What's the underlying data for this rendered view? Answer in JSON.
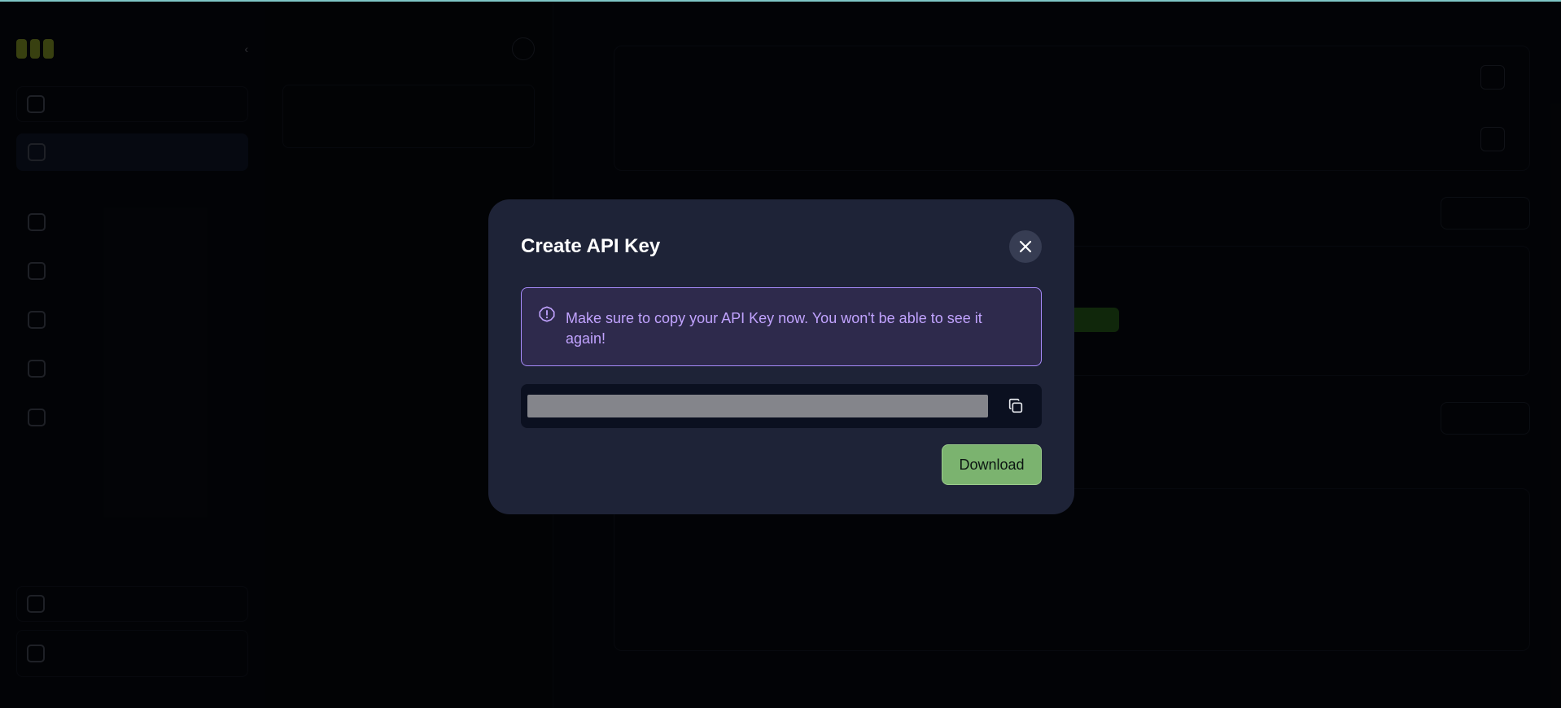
{
  "modal": {
    "title": "Create API Key",
    "alert_message": "Make sure to copy your API Key now. You won't be able to see it again!",
    "api_key_value": "",
    "download_label": "Download"
  },
  "colors": {
    "modal_bg": "#1e2337",
    "alert_border": "#a78bfa",
    "alert_text": "#c1a3ff",
    "download_bg": "#7bb36f",
    "overlay": "rgba(0,0,0,0.72)"
  },
  "icons": {
    "close": "close-icon",
    "alert": "alert-circle-icon",
    "copy": "copy-icon"
  }
}
